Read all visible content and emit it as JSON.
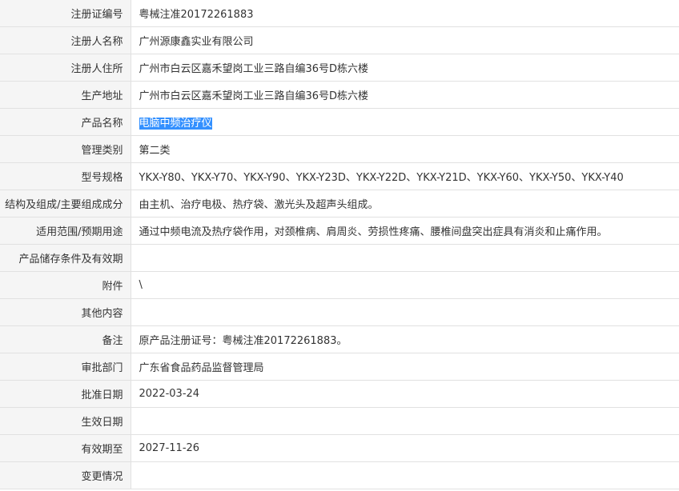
{
  "rows": [
    {
      "label": "注册证编号",
      "value": "粤械注准20172261883"
    },
    {
      "label": "注册人名称",
      "value": "广州源康鑫实业有限公司"
    },
    {
      "label": "注册人住所",
      "value": "广州市白云区嘉禾望岗工业三路自编36号D栋六楼"
    },
    {
      "label": "生产地址",
      "value": "广州市白云区嘉禾望岗工业三路自编36号D栋六楼"
    },
    {
      "label": "产品名称",
      "value": "电脑中频治疗仪",
      "selected": true
    },
    {
      "label": "管理类别",
      "value": "第二类"
    },
    {
      "label": "型号规格",
      "value": "YKX-Y80、YKX-Y70、YKX-Y90、YKX-Y23D、YKX-Y22D、YKX-Y21D、YKX-Y60、YKX-Y50、YKX-Y40"
    },
    {
      "label": "结构及组成/主要组成成分",
      "value": "由主机、治疗电极、热疗袋、激光头及超声头组成。"
    },
    {
      "label": "适用范围/预期用途",
      "value": "通过中频电流及热疗袋作用，对颈椎病、肩周炎、劳损性疼痛、腰椎间盘突出症具有消炎和止痛作用。"
    },
    {
      "label": "产品储存条件及有效期",
      "value": ""
    },
    {
      "label": "附件",
      "value": "\\"
    },
    {
      "label": "其他内容",
      "value": ""
    },
    {
      "label": "备注",
      "value": "原产品注册证号：粤械注准20172261883。"
    },
    {
      "label": "审批部门",
      "value": "广东省食品药品监督管理局"
    },
    {
      "label": "批准日期",
      "value": "2022-03-24"
    },
    {
      "label": "生效日期",
      "value": ""
    },
    {
      "label": "有效期至",
      "value": "2027-11-26"
    },
    {
      "label": "变更情况",
      "value": ""
    }
  ]
}
